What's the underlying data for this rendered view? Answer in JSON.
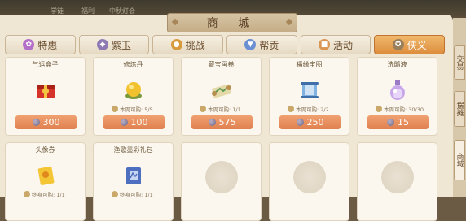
{
  "title": "商 城",
  "top_strip": [
    "学徒",
    "福利",
    "中秋灯会"
  ],
  "tabs": [
    {
      "label": "特惠",
      "icon": "flower-icon",
      "color": "#b46fc9"
    },
    {
      "label": "紫玉",
      "icon": "jade-icon",
      "color": "#8d7ab3"
    },
    {
      "label": "挑战",
      "icon": "coin-icon",
      "color": "#d79a3d"
    },
    {
      "label": "帮贡",
      "icon": "shield-icon",
      "color": "#6b8fd3"
    },
    {
      "label": "活动",
      "icon": "gift-icon",
      "color": "#d99652"
    },
    {
      "label": "侠义",
      "icon": "medal-icon",
      "color": "#9a7f5b",
      "active": true
    }
  ],
  "side_tabs": [
    "交易",
    "摆摊",
    "商城"
  ],
  "items": [
    {
      "name": "气运盒子",
      "limit": "",
      "price": "300",
      "icon": "red-box-icon"
    },
    {
      "name": "修炼丹",
      "limit": "本周可购: 5/5",
      "price": "100",
      "icon": "gold-pill-icon"
    },
    {
      "name": "藏宝画卷",
      "limit": "本周可购: 1/1",
      "price": "575",
      "icon": "scroll-map-icon"
    },
    {
      "name": "福缘宝图",
      "limit": "本周可购: 2/2",
      "price": "250",
      "icon": "blue-scroll-icon"
    },
    {
      "name": "洗髓液",
      "limit": "本周可购: 30/30",
      "price": "15",
      "icon": "potion-icon"
    },
    {
      "name": "头像券",
      "limit": "终身可购: 1/1",
      "price": "",
      "icon": "yellow-ticket-icon"
    },
    {
      "name": "渔歌墨彩礼包",
      "limit": "终身可购: 1/1",
      "price": "",
      "icon": "blue-book-icon"
    }
  ],
  "empty_slots": 3
}
